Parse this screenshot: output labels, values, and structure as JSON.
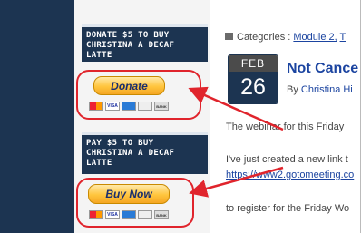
{
  "sidebar": {
    "donate_widget": {
      "heading_line1": "DONATE $5 TO BUY",
      "heading_line2": "CHRISTINA A DECAF",
      "heading_line3": "LATTE",
      "button_label": "Donate"
    },
    "pay_widget": {
      "heading_line1": "PAY $5 TO BUY",
      "heading_line2": "CHRISTINA A DECAF",
      "heading_line3": "LATTE",
      "button_label": "Buy Now"
    },
    "card_icons": [
      "mastercard-icon",
      "visa-icon",
      "amex-icon",
      "discover-icon",
      "bank-icon"
    ],
    "card_labels": {
      "visa": "VISA",
      "bank": "BANK"
    }
  },
  "post": {
    "categories_label": "Categories :",
    "category_1": "Module 2,",
    "category_2": "T",
    "date_month": "FEB",
    "date_day": "26",
    "title": "Not Cance",
    "by_label": "By",
    "author": "Christina Hi",
    "para_1": "The webinar for this Friday",
    "para_2": "I've just created a new link t",
    "para_link": "https://www2.gotomeeting.co",
    "para_3": "to register for the Friday Wo"
  },
  "colors": {
    "navy": "#1c3451",
    "annotation_red": "#e0242c",
    "link_blue": "#1b44a0",
    "paypal_gold": "#ffc53d"
  }
}
